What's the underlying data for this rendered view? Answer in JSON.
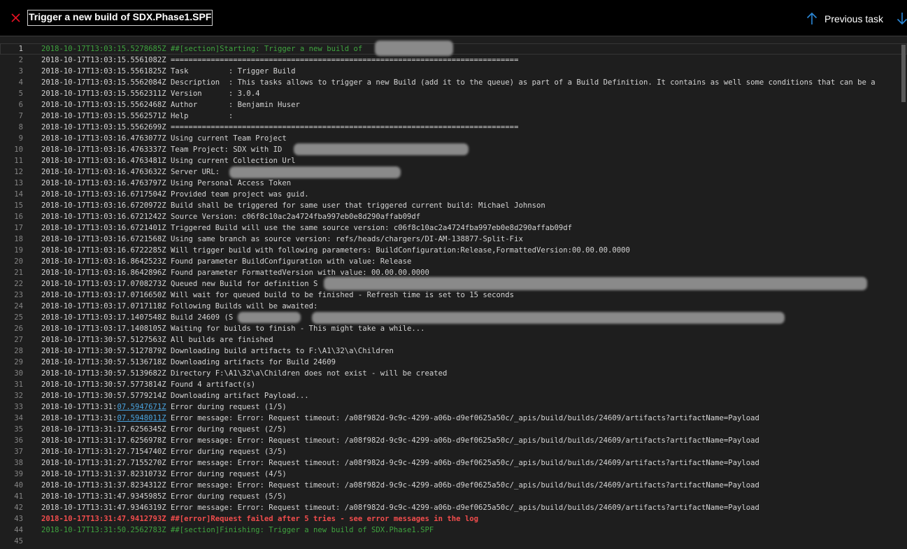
{
  "header": {
    "title": "Trigger a new build of SDX.Phase1.SPF",
    "previous_task_label": "Previous task",
    "close_icon": "close-icon",
    "up_icon": "arrow-up-icon",
    "down_icon": "arrow-down-icon",
    "colors": {
      "close": "#e81123",
      "arrow": "#2b88d8",
      "background": "#000000"
    }
  },
  "log": {
    "current_line": 1,
    "lines": [
      {
        "n": "1",
        "parts": [
          {
            "t": "2018-10-17T13:03:15.5278685Z ##[section]Starting: Trigger a new build of "
          }
        ],
        "kind": "section"
      },
      {
        "n": "2",
        "parts": [
          {
            "t": "2018-10-17T13:03:15.5561082Z =============================================================================="
          }
        ],
        "kind": "normal"
      },
      {
        "n": "3",
        "parts": [
          {
            "t": "2018-10-17T13:03:15.5561825Z Task         : Trigger Build"
          }
        ],
        "kind": "normal"
      },
      {
        "n": "4",
        "parts": [
          {
            "t": "2018-10-17T13:03:15.5562084Z Description  : This tasks allows to trigger a new Build (add it to the queue) as part of a Build Definition. It contains as well some conditions that can be a"
          }
        ],
        "kind": "normal"
      },
      {
        "n": "5",
        "parts": [
          {
            "t": "2018-10-17T13:03:15.5562311Z Version      : 3.0.4"
          }
        ],
        "kind": "normal"
      },
      {
        "n": "6",
        "parts": [
          {
            "t": "2018-10-17T13:03:15.5562468Z Author       : Benjamin Huser"
          }
        ],
        "kind": "normal"
      },
      {
        "n": "7",
        "parts": [
          {
            "t": "2018-10-17T13:03:15.5562571Z Help         :"
          }
        ],
        "kind": "normal"
      },
      {
        "n": "8",
        "parts": [
          {
            "t": "2018-10-17T13:03:15.5562699Z =============================================================================="
          }
        ],
        "kind": "normal"
      },
      {
        "n": "9",
        "parts": [
          {
            "t": "2018-10-17T13:03:16.4763077Z Using current Team Project"
          }
        ],
        "kind": "normal"
      },
      {
        "n": "10",
        "parts": [
          {
            "t": "2018-10-17T13:03:16.4763337Z Team Project: SDX with ID "
          }
        ],
        "kind": "normal"
      },
      {
        "n": "11",
        "parts": [
          {
            "t": "2018-10-17T13:03:16.4763481Z Using current Collection Url"
          }
        ],
        "kind": "normal"
      },
      {
        "n": "12",
        "parts": [
          {
            "t": "2018-10-17T13:03:16.4763632Z Server URL: "
          }
        ],
        "kind": "normal"
      },
      {
        "n": "13",
        "parts": [
          {
            "t": "2018-10-17T13:03:16.4763797Z Using Personal Access Token"
          }
        ],
        "kind": "normal"
      },
      {
        "n": "14",
        "parts": [
          {
            "t": "2018-10-17T13:03:16.6717504Z Provided team project was guid."
          }
        ],
        "kind": "normal"
      },
      {
        "n": "15",
        "parts": [
          {
            "t": "2018-10-17T13:03:16.6720972Z Build shall be triggered for same user that triggered current build: Michael Johnson"
          }
        ],
        "kind": "normal"
      },
      {
        "n": "16",
        "parts": [
          {
            "t": "2018-10-17T13:03:16.6721242Z Source Version: c06f8c10ac2a4724fba997eb0e8d290affab09df"
          }
        ],
        "kind": "normal"
      },
      {
        "n": "17",
        "parts": [
          {
            "t": "2018-10-17T13:03:16.6721401Z Triggered Build will use the same source version: c06f8c10ac2a4724fba997eb0e8d290affab09df"
          }
        ],
        "kind": "normal"
      },
      {
        "n": "18",
        "parts": [
          {
            "t": "2018-10-17T13:03:16.6721568Z Using same branch as source version: refs/heads/chargers/DI-AM-138877-Split-Fix"
          }
        ],
        "kind": "normal"
      },
      {
        "n": "19",
        "parts": [
          {
            "t": "2018-10-17T13:03:16.6722285Z Will trigger build with following parameters: BuildConfiguration:Release,FormattedVersion:00.00.00.0000"
          }
        ],
        "kind": "normal"
      },
      {
        "n": "20",
        "parts": [
          {
            "t": "2018-10-17T13:03:16.8642523Z Found parameter BuildConfiguration with value: Release"
          }
        ],
        "kind": "normal"
      },
      {
        "n": "21",
        "parts": [
          {
            "t": "2018-10-17T13:03:16.8642896Z Found parameter FormattedVersion with value: 00.00.00.0000"
          }
        ],
        "kind": "normal"
      },
      {
        "n": "22",
        "parts": [
          {
            "t": "2018-10-17T13:03:17.0708273Z Queued new Build for definition S"
          }
        ],
        "kind": "normal"
      },
      {
        "n": "23",
        "parts": [
          {
            "t": "2018-10-17T13:03:17.0716650Z Will wait for queued build to be finished - Refresh time is set to 15 seconds"
          }
        ],
        "kind": "normal"
      },
      {
        "n": "24",
        "parts": [
          {
            "t": "2018-10-17T13:03:17.0717118Z Following Builds will be awaited:"
          }
        ],
        "kind": "normal"
      },
      {
        "n": "25",
        "parts": [
          {
            "t": "2018-10-17T13:03:17.1407548Z Build 24609 (S            ): "
          }
        ],
        "kind": "normal"
      },
      {
        "n": "26",
        "parts": [
          {
            "t": "2018-10-17T13:03:17.1408105Z Waiting for builds to finish - This might take a while..."
          }
        ],
        "kind": "normal"
      },
      {
        "n": "27",
        "parts": [
          {
            "t": "2018-10-17T13:30:57.5127563Z All builds are finished"
          }
        ],
        "kind": "normal"
      },
      {
        "n": "28",
        "parts": [
          {
            "t": "2018-10-17T13:30:57.5127879Z Downloading build artifacts to F:\\A1\\32\\a\\Children"
          }
        ],
        "kind": "normal"
      },
      {
        "n": "29",
        "parts": [
          {
            "t": "2018-10-17T13:30:57.5136718Z Downloading artifacts for Build 24609"
          }
        ],
        "kind": "normal"
      },
      {
        "n": "30",
        "parts": [
          {
            "t": "2018-10-17T13:30:57.5139682Z Directory F:\\A1\\32\\a\\Children does not exist - will be created"
          }
        ],
        "kind": "normal"
      },
      {
        "n": "31",
        "parts": [
          {
            "t": "2018-10-17T13:30:57.5773814Z Found 4 artifact(s)"
          }
        ],
        "kind": "normal"
      },
      {
        "n": "32",
        "parts": [
          {
            "t": "2018-10-17T13:30:57.5779214Z Downloading artifact Payload..."
          }
        ],
        "kind": "normal"
      },
      {
        "n": "33",
        "parts": [
          {
            "t": "2018-10-17T13:31:"
          },
          {
            "t": "07.5947671Z",
            "link": true
          },
          {
            "t": " Error during request (1/5)"
          }
        ],
        "kind": "normal"
      },
      {
        "n": "34",
        "parts": [
          {
            "t": "2018-10-17T13:31:"
          },
          {
            "t": "07.5948011Z",
            "link": true
          },
          {
            "t": " Error message: Error: Request timeout: /a08f982d-9c9c-4299-a06b-d9ef0625a50c/_apis/build/builds/24609/artifacts?artifactName=Payload"
          }
        ],
        "kind": "normal"
      },
      {
        "n": "35",
        "parts": [
          {
            "t": "2018-10-17T13:31:17.6256345Z Error during request (2/5)"
          }
        ],
        "kind": "normal"
      },
      {
        "n": "36",
        "parts": [
          {
            "t": "2018-10-17T13:31:17.6256978Z Error message: Error: Request timeout: /a08f982d-9c9c-4299-a06b-d9ef0625a50c/_apis/build/builds/24609/artifacts?artifactName=Payload"
          }
        ],
        "kind": "normal"
      },
      {
        "n": "37",
        "parts": [
          {
            "t": "2018-10-17T13:31:27.7154740Z Error during request (3/5)"
          }
        ],
        "kind": "normal"
      },
      {
        "n": "38",
        "parts": [
          {
            "t": "2018-10-17T13:31:27.7155270Z Error message: Error: Request timeout: /a08f982d-9c9c-4299-a06b-d9ef0625a50c/_apis/build/builds/24609/artifacts?artifactName=Payload"
          }
        ],
        "kind": "normal"
      },
      {
        "n": "39",
        "parts": [
          {
            "t": "2018-10-17T13:31:37.8231073Z Error during request (4/5)"
          }
        ],
        "kind": "normal"
      },
      {
        "n": "40",
        "parts": [
          {
            "t": "2018-10-17T13:31:37.8234312Z Error message: Error: Request timeout: /a08f982d-9c9c-4299-a06b-d9ef0625a50c/_apis/build/builds/24609/artifacts?artifactName=Payload"
          }
        ],
        "kind": "normal"
      },
      {
        "n": "41",
        "parts": [
          {
            "t": "2018-10-17T13:31:47.9345985Z Error during request (5/5)"
          }
        ],
        "kind": "normal"
      },
      {
        "n": "42",
        "parts": [
          {
            "t": "2018-10-17T13:31:47.9346319Z Error message: Error: Request timeout: /a08f982d-9c9c-4299-a06b-d9ef0625a50c/_apis/build/builds/24609/artifacts?artifactName=Payload"
          }
        ],
        "kind": "normal"
      },
      {
        "n": "43",
        "parts": [
          {
            "t": "2018-10-17T13:31:47.9412793Z ##[error]Request failed after 5 tries - see error messages in the log"
          }
        ],
        "kind": "error"
      },
      {
        "n": "44",
        "parts": [
          {
            "t": "2018-10-17T13:31:50.2562783Z ##[section]Finishing: Trigger a new build of SDX.Phase1.SPF"
          }
        ],
        "kind": "section"
      },
      {
        "n": "45",
        "parts": [
          {
            "t": ""
          }
        ],
        "kind": "normal"
      }
    ]
  }
}
